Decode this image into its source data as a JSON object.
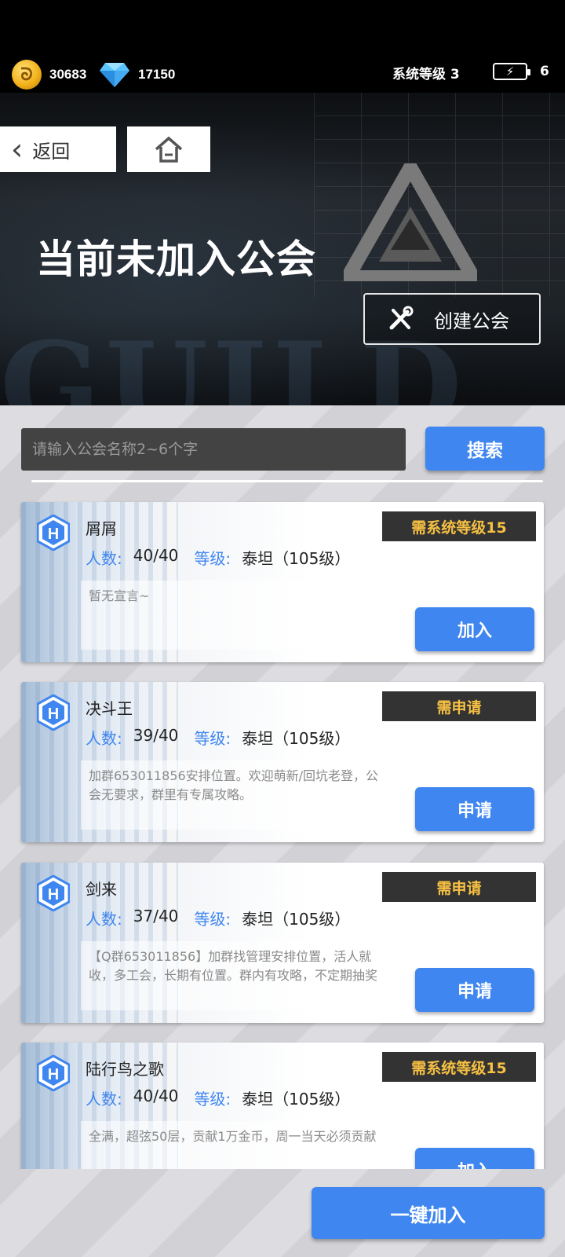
{
  "topbar": {
    "gold": "30683",
    "diamond": "17150",
    "system_level": "系统等级 3",
    "energy": "6",
    "coin_icon": "gold-coin-icon",
    "diamond_icon": "diamond-icon",
    "energy_icon": "battery-lightning-icon"
  },
  "header": {
    "back_label": "返回",
    "title": "当前未加入公会",
    "create_label": "创建公会",
    "bg_word": "GUILD"
  },
  "search": {
    "placeholder": "请输入公会名称2~6个字",
    "button": "搜索"
  },
  "guilds": [
    {
      "name": "屑屑",
      "members_label": "人数:",
      "members": "40/40",
      "level_label": "等级:",
      "level": "泰坦（105级）",
      "requirement": "需系统等级15",
      "declaration": "暂无宣言~",
      "action": "加入"
    },
    {
      "name": "决斗王",
      "members_label": "人数:",
      "members": "39/40",
      "level_label": "等级:",
      "level": "泰坦（105级）",
      "requirement": "需申请",
      "declaration": "加群653011856安排位置。欢迎萌新/回坑老登，公会无要求，群里有专属攻略。",
      "action": "申请"
    },
    {
      "name": "剑来",
      "members_label": "人数:",
      "members": "37/40",
      "level_label": "等级:",
      "level": "泰坦（105级）",
      "requirement": "需申请",
      "declaration": "【Q群653011856】加群找管理安排位置，活人就收，多工会，长期有位置。群内有攻略，不定期抽奖",
      "action": "申请"
    },
    {
      "name": "陆行鸟之歌",
      "members_label": "人数:",
      "members": "40/40",
      "level_label": "等级:",
      "level": "泰坦（105级）",
      "requirement": "需系统等级15",
      "declaration": "全满，超弦50层，贡献1万金币，周一当天必须贡献",
      "action": "加入"
    }
  ],
  "footer": {
    "one_click_join": "一键加入"
  },
  "colors": {
    "accent_blue": "#3f86f0",
    "requirement_gold": "#f6c043",
    "dark": "#333333"
  }
}
